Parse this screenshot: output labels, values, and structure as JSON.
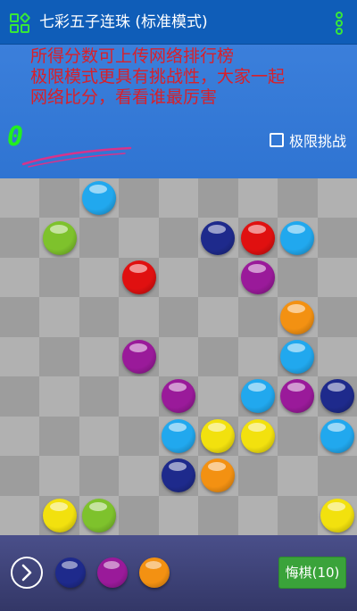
{
  "app": {
    "title": "七彩五子连珠 (标准模式)",
    "icon": "grid-apps-icon",
    "menu_icon": "more-vert-icon"
  },
  "notice": {
    "text": "所得分数可上传网络排行榜\n极限模式更具有挑战性，大家一起\n网络比分，看看谁最厉害"
  },
  "score": {
    "value": "0"
  },
  "limit_challenge": {
    "label": "极限挑战",
    "checked": false
  },
  "board": {
    "cols": 9,
    "rows": 9,
    "balls": [
      {
        "row": 0,
        "col": 2,
        "color": "cyan"
      },
      {
        "row": 1,
        "col": 1,
        "color": "green"
      },
      {
        "row": 1,
        "col": 5,
        "color": "navy"
      },
      {
        "row": 1,
        "col": 6,
        "color": "red"
      },
      {
        "row": 1,
        "col": 7,
        "color": "cyan"
      },
      {
        "row": 2,
        "col": 3,
        "color": "red"
      },
      {
        "row": 2,
        "col": 6,
        "color": "purple"
      },
      {
        "row": 3,
        "col": 7,
        "color": "orange"
      },
      {
        "row": 4,
        "col": 3,
        "color": "purple"
      },
      {
        "row": 4,
        "col": 7,
        "color": "cyan"
      },
      {
        "row": 5,
        "col": 4,
        "color": "purple"
      },
      {
        "row": 5,
        "col": 6,
        "color": "cyan"
      },
      {
        "row": 5,
        "col": 7,
        "color": "purple"
      },
      {
        "row": 5,
        "col": 8,
        "color": "navy"
      },
      {
        "row": 6,
        "col": 4,
        "color": "cyan"
      },
      {
        "row": 6,
        "col": 5,
        "color": "yellow"
      },
      {
        "row": 6,
        "col": 6,
        "color": "yellow"
      },
      {
        "row": 6,
        "col": 8,
        "color": "cyan"
      },
      {
        "row": 7,
        "col": 4,
        "color": "navy"
      },
      {
        "row": 7,
        "col": 5,
        "color": "orange"
      },
      {
        "row": 8,
        "col": 1,
        "color": "yellow"
      },
      {
        "row": 8,
        "col": 2,
        "color": "green"
      },
      {
        "row": 8,
        "col": 8,
        "color": "yellow"
      }
    ]
  },
  "next_balls": [
    "navy",
    "purple",
    "orange"
  ],
  "undo": {
    "label": "悔棋(10)"
  },
  "colors": {
    "cyan": "#21a8ee",
    "green": "#7ec22c",
    "navy": "#1e2a8c",
    "red": "#e01010",
    "purple": "#9a1a9a",
    "orange": "#f39112",
    "yellow": "#f2e10e",
    "score_green": "#22ee22",
    "notice_red": "#d8202a",
    "undo_green": "#3aa33a"
  }
}
